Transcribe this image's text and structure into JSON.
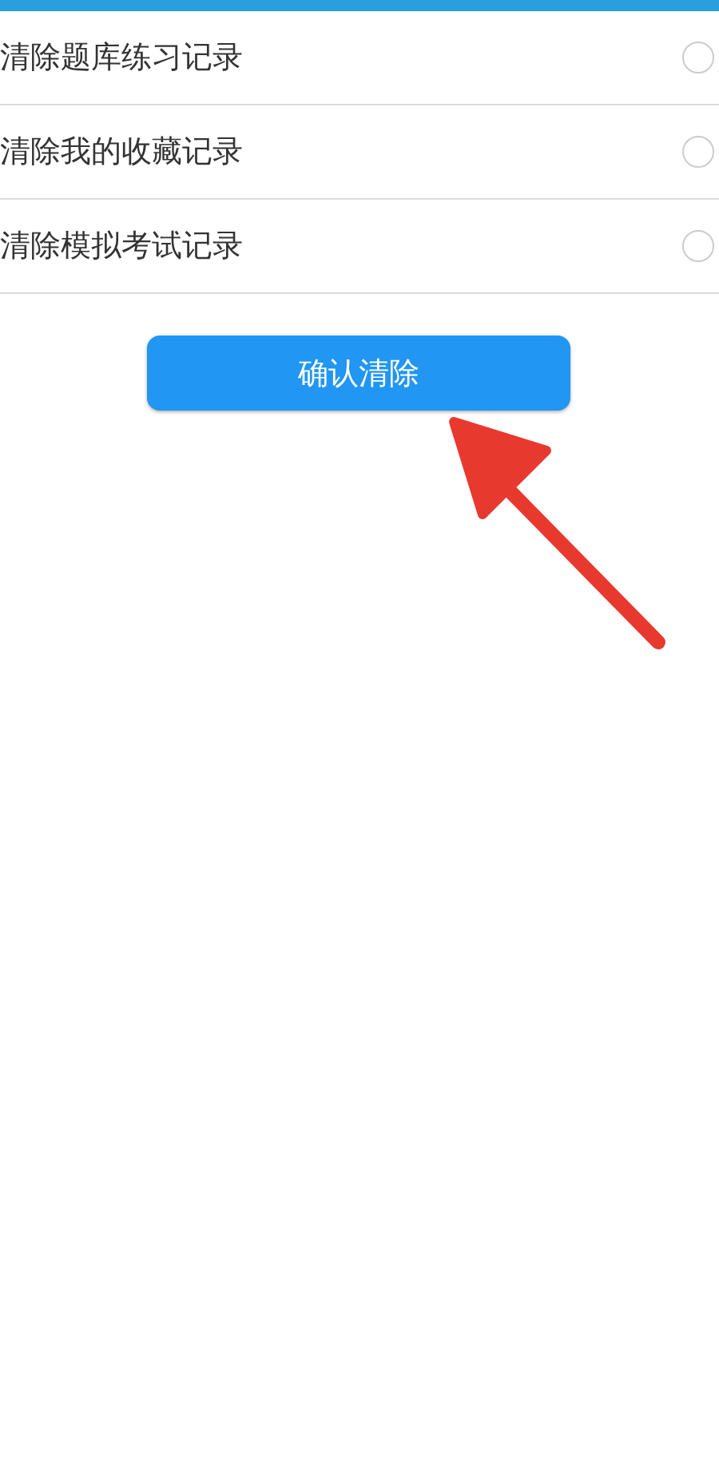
{
  "options": [
    {
      "label": "清除题库练习记录",
      "selected": false
    },
    {
      "label": "清除我的收藏记录",
      "selected": false
    },
    {
      "label": "清除模拟考试记录",
      "selected": false
    }
  ],
  "confirm_button": "确认清除"
}
